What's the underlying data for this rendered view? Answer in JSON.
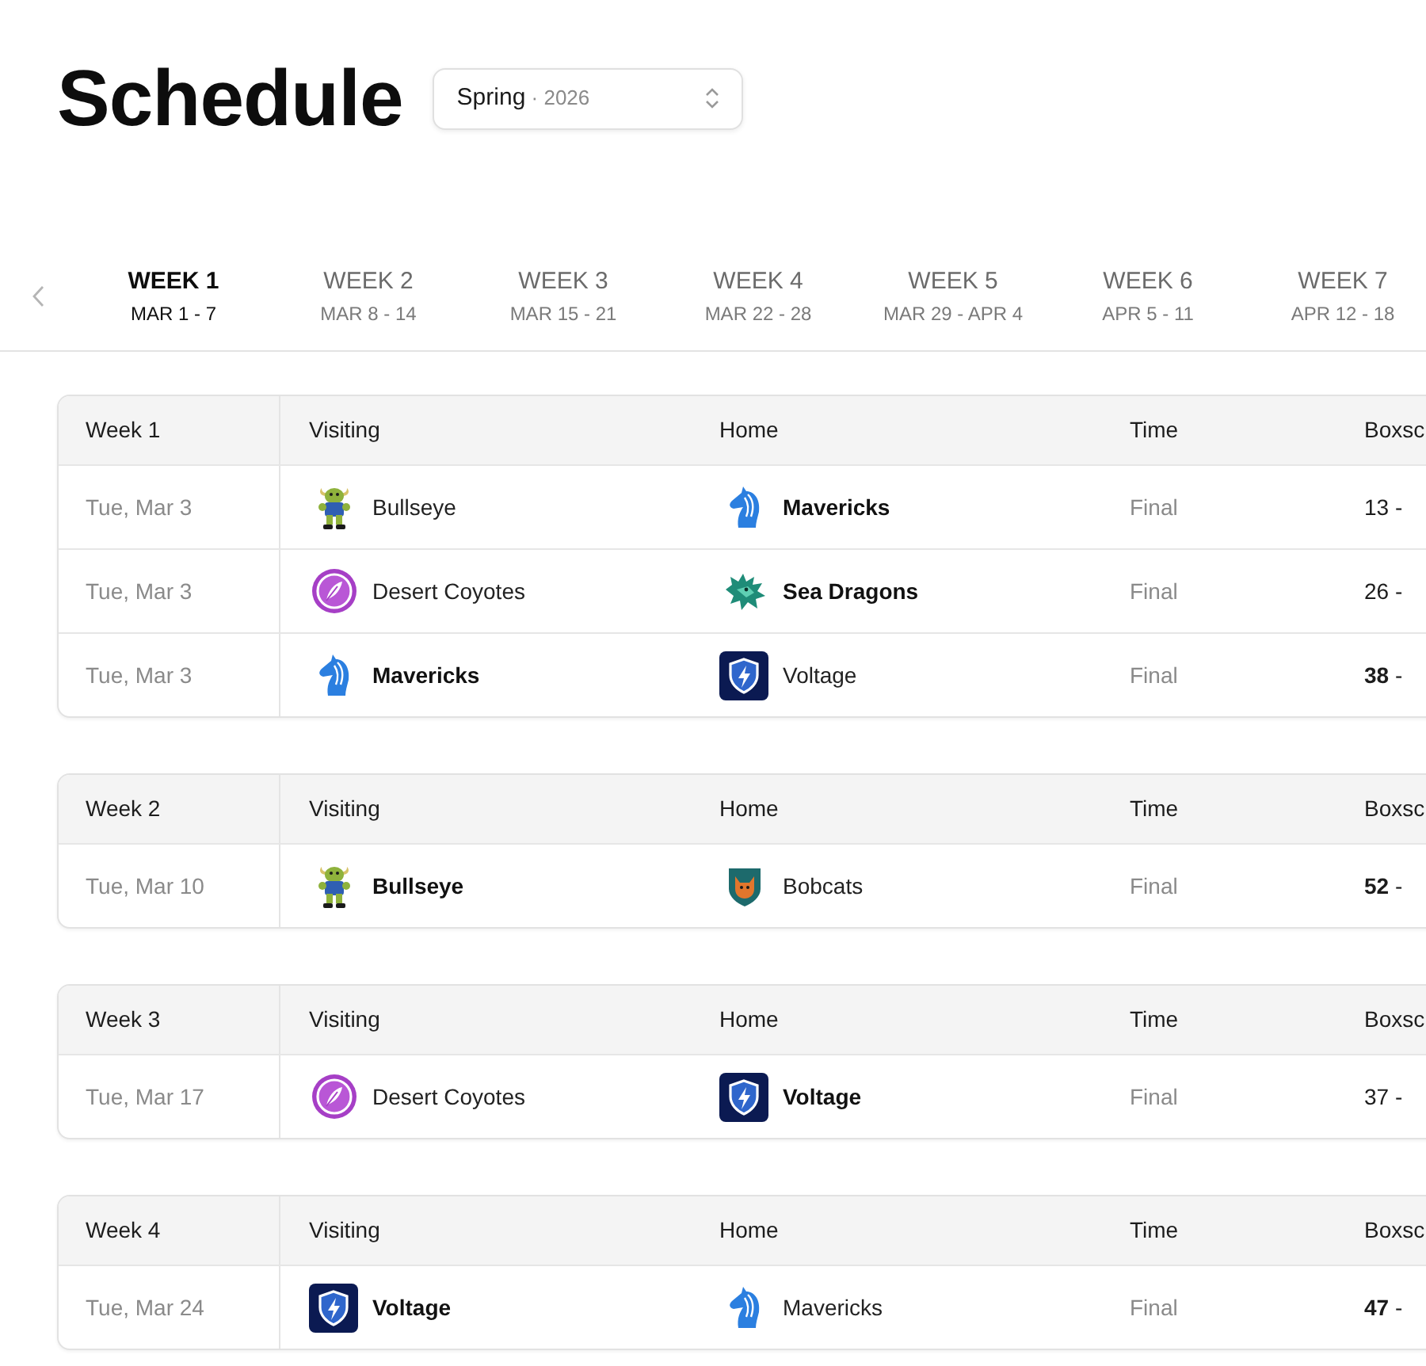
{
  "header": {
    "title": "Schedule",
    "season_select": {
      "value": "Spring",
      "detail": "· 2026"
    }
  },
  "week_tabs": [
    {
      "label": "WEEK 1",
      "dates": "MAR 1 - 7",
      "selected": true
    },
    {
      "label": "WEEK 2",
      "dates": "MAR 8 - 14",
      "selected": false
    },
    {
      "label": "WEEK 3",
      "dates": "MAR 15 - 21",
      "selected": false
    },
    {
      "label": "WEEK 4",
      "dates": "MAR 22 - 28",
      "selected": false
    },
    {
      "label": "WEEK 5",
      "dates": "MAR 29 - APR 4",
      "selected": false
    },
    {
      "label": "WEEK 6",
      "dates": "APR 5 - 11",
      "selected": false
    },
    {
      "label": "WEEK 7",
      "dates": "APR 12 - 18",
      "selected": false
    }
  ],
  "weeks": [
    {
      "heading": "Week 1",
      "columns": [
        "Visiting",
        "Home",
        "Time",
        "Boxsc"
      ],
      "games": [
        {
          "date": "Tue, Mar 3",
          "visiting": {
            "name": "Bullseye",
            "kind": "bull",
            "winner": false
          },
          "home": {
            "name": "Mavericks",
            "kind": "horse",
            "winner": true
          },
          "time": "Final",
          "boxscore": "13 -"
        },
        {
          "date": "Tue, Mar 3",
          "visiting": {
            "name": "Desert Coyotes",
            "kind": "feather",
            "winner": false
          },
          "home": {
            "name": "Sea Dragons",
            "kind": "dragon",
            "winner": true
          },
          "time": "Final",
          "boxscore": "26 -"
        },
        {
          "date": "Tue, Mar 3",
          "visiting": {
            "name": "Mavericks",
            "kind": "horse",
            "winner": true
          },
          "home": {
            "name": "Voltage",
            "kind": "bolt",
            "winner": false
          },
          "time": "Final",
          "boxscore": "**38** -"
        }
      ]
    },
    {
      "heading": "Week 2",
      "columns": [
        "Visiting",
        "Home",
        "Time",
        "Boxsc"
      ],
      "games": [
        {
          "date": "Tue, Mar 10",
          "visiting": {
            "name": "Bullseye",
            "kind": "bull",
            "winner": true
          },
          "home": {
            "name": "Bobcats",
            "kind": "cat",
            "winner": false
          },
          "time": "Final",
          "boxscore": "**52** -"
        }
      ]
    },
    {
      "heading": "Week 3",
      "columns": [
        "Visiting",
        "Home",
        "Time",
        "Boxsc"
      ],
      "games": [
        {
          "date": "Tue, Mar 17",
          "visiting": {
            "name": "Desert Coyotes",
            "kind": "feather",
            "winner": false
          },
          "home": {
            "name": "Voltage",
            "kind": "bolt",
            "winner": true
          },
          "time": "Final",
          "boxscore": "37 -"
        }
      ]
    },
    {
      "heading": "Week 4",
      "columns": [
        "Visiting",
        "Home",
        "Time",
        "Boxsc"
      ],
      "games": [
        {
          "date": "Tue, Mar 24",
          "visiting": {
            "name": "Voltage",
            "kind": "bolt",
            "winner": true
          },
          "home": {
            "name": "Mavericks",
            "kind": "horse",
            "winner": false
          },
          "time": "Final",
          "boxscore": "**47** -"
        }
      ]
    }
  ]
}
